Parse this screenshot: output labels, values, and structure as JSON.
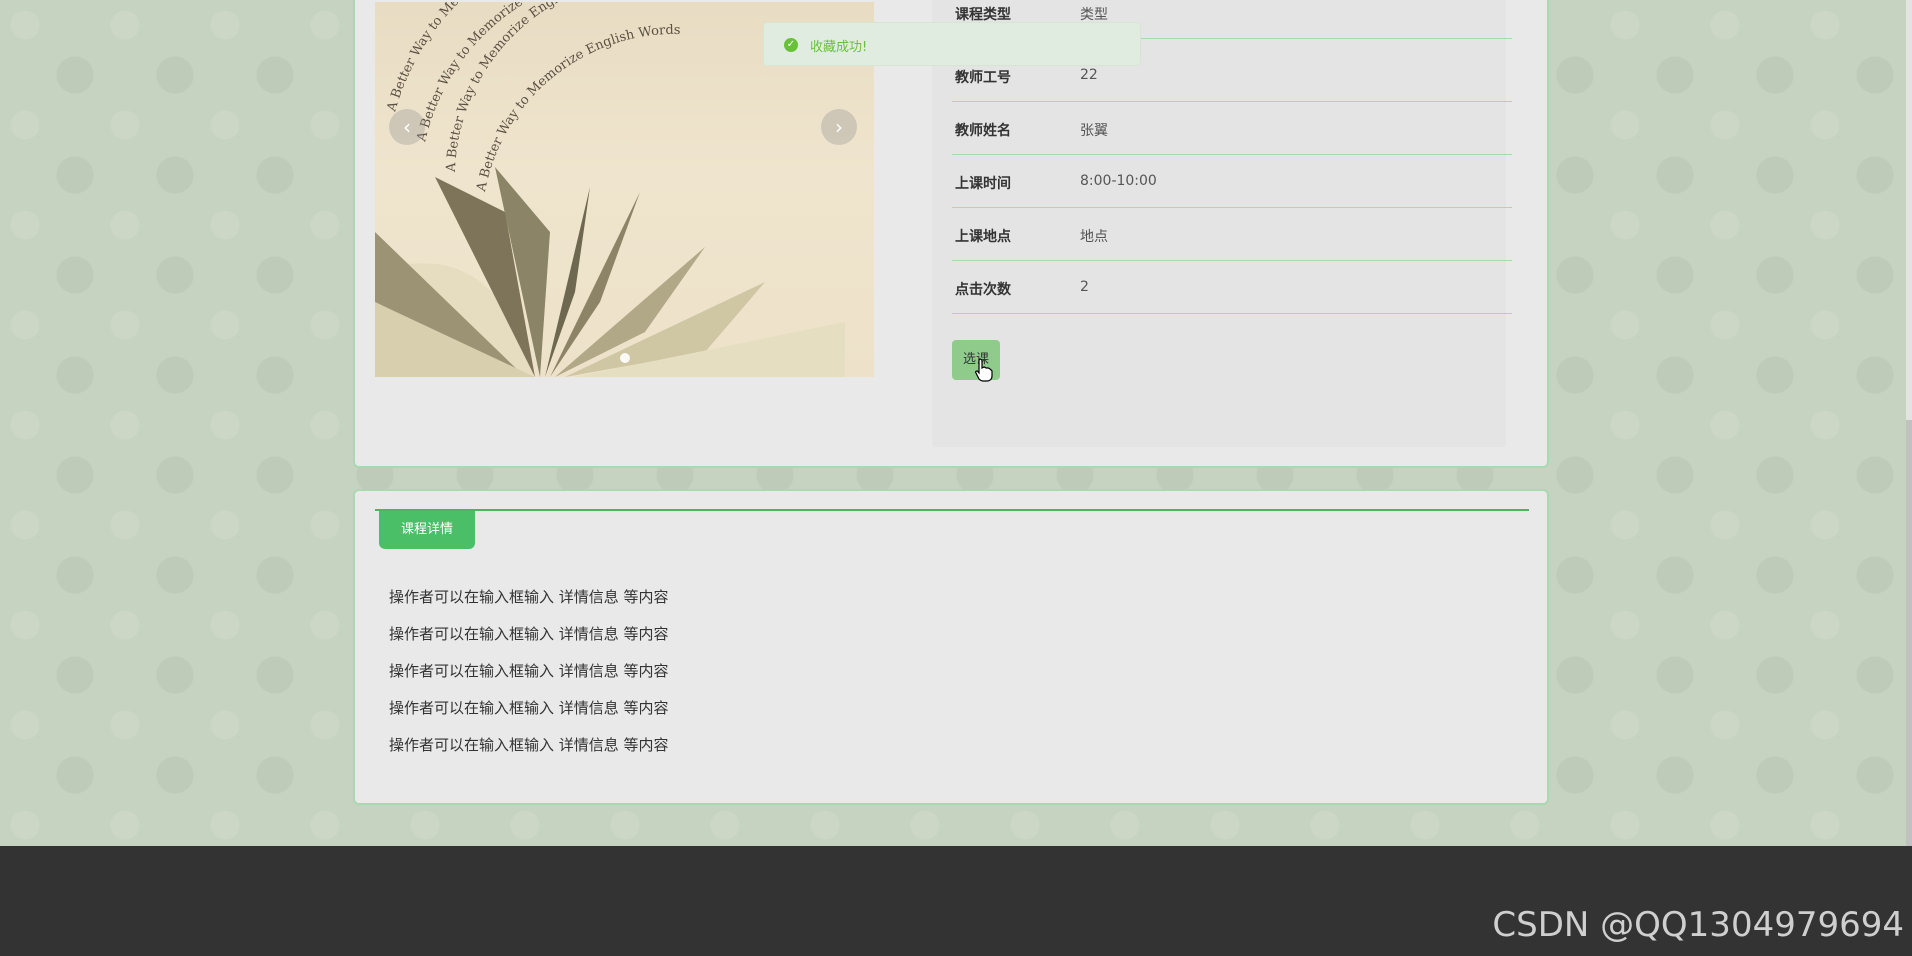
{
  "course_info": {
    "rows": [
      {
        "label": "课程类型",
        "value": "类型"
      },
      {
        "label": "教师工号",
        "value": "22"
      },
      {
        "label": "教师姓名",
        "value": "张翼"
      },
      {
        "label": "上课时间",
        "value": "8:00-10:00"
      },
      {
        "label": "上课地点",
        "value": "地点"
      },
      {
        "label": "点击次数",
        "value": "2"
      }
    ],
    "select_button": "选课"
  },
  "carousel": {
    "prev_icon": "chevron-left-icon",
    "next_icon": "chevron-right-icon",
    "prev_glyph": "‹",
    "next_glyph": "›",
    "image_text": "A Better Way to Memorize English Words"
  },
  "detail": {
    "tab_label": "课程详情",
    "lines": [
      "操作者可以在输入框输入  详情信息  等内容",
      "操作者可以在输入框输入  详情信息  等内容",
      "操作者可以在输入框输入  详情信息  等内容",
      "操作者可以在输入框输入  详情信息  等内容",
      "操作者可以在输入框输入  详情信息  等内容"
    ]
  },
  "toast": {
    "message": "收藏成功!",
    "icon": "check-circle-icon",
    "color": "#67c23a"
  },
  "watermark": "CSDN @QQ1304979694",
  "colors": {
    "accent": "#4bbf68",
    "border": "#a9d9b0",
    "footer": "#333333"
  }
}
